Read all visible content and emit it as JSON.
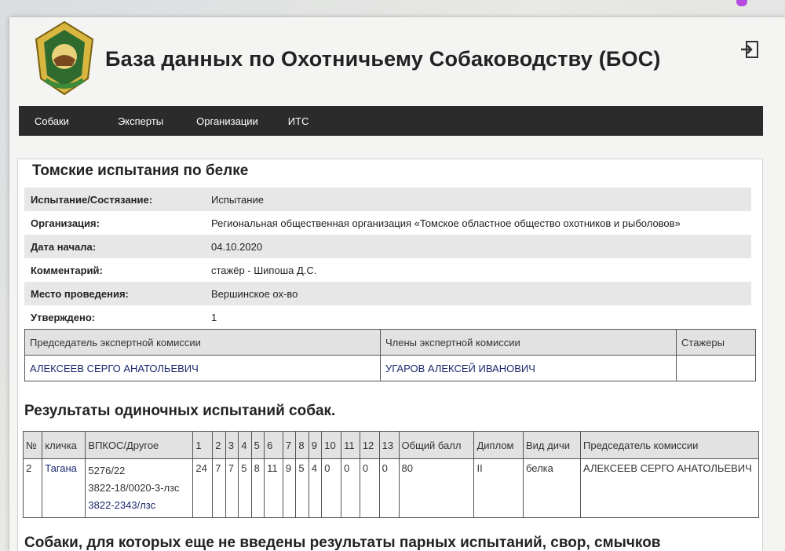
{
  "site": {
    "title": "База данных по Охотничьему Собаководству (БОС)",
    "logout_icon": "logout-icon"
  },
  "nav": [
    {
      "label": "Собаки"
    },
    {
      "label": "Эксперты"
    },
    {
      "label": "Организации"
    },
    {
      "label": "ИТС"
    }
  ],
  "event": {
    "title": "Томские испытания по белке",
    "fields": [
      {
        "key": "Испытание/Состязание:",
        "value": "Испытание"
      },
      {
        "key": "Организация:",
        "value": "Региональная общественная организация «Томское областное общество охотников и рыболовов»"
      },
      {
        "key": "Дата начала:",
        "value": "04.10.2020"
      },
      {
        "key": "Комментарий:",
        "value": "стажёр - Шипоша Д.С."
      },
      {
        "key": "Место проведения:",
        "value": "Вершинское ох-во"
      },
      {
        "key": "Утверждено:",
        "value": "1"
      }
    ]
  },
  "commission": {
    "headers": [
      "Председатель экспертной комиссии",
      "Члены экспертной комиссии",
      "Стажеры"
    ],
    "chairman": "АЛЕКСЕЕВ СЕРГО АНАТОЛЬЕВИЧ",
    "members": "УГАРОВ АЛЕКСЕЙ ИВАНОВИЧ",
    "trainees": ""
  },
  "results": {
    "title": "Результаты одиночных испытаний собак.",
    "headers": [
      "№",
      "кличка",
      "ВПКОС/Другое",
      "1",
      "2",
      "3",
      "4",
      "5",
      "6",
      "7",
      "8",
      "9",
      "10",
      "11",
      "12",
      "13",
      "Общий балл",
      "Диплом",
      "Вид дичи",
      "Председатель комиссии"
    ],
    "rows": [
      {
        "num": "2",
        "name": "Тагана",
        "docs": [
          "5276/22",
          "3822-18/0020-3-лзс",
          "3822-2343/лзс"
        ],
        "scores": [
          "24",
          "7",
          "7",
          "5",
          "8",
          "11",
          "9",
          "5",
          "4",
          "0",
          "0",
          "0",
          "0"
        ],
        "total": "80",
        "diploma": "II",
        "game": "белка",
        "chairman": "АЛЕКСЕЕВ СЕРГО АНАТОЛЬЕВИЧ"
      }
    ]
  },
  "next_section_title": "Собаки, для которых еще не введены результаты парных испытаний, свор, смычков"
}
